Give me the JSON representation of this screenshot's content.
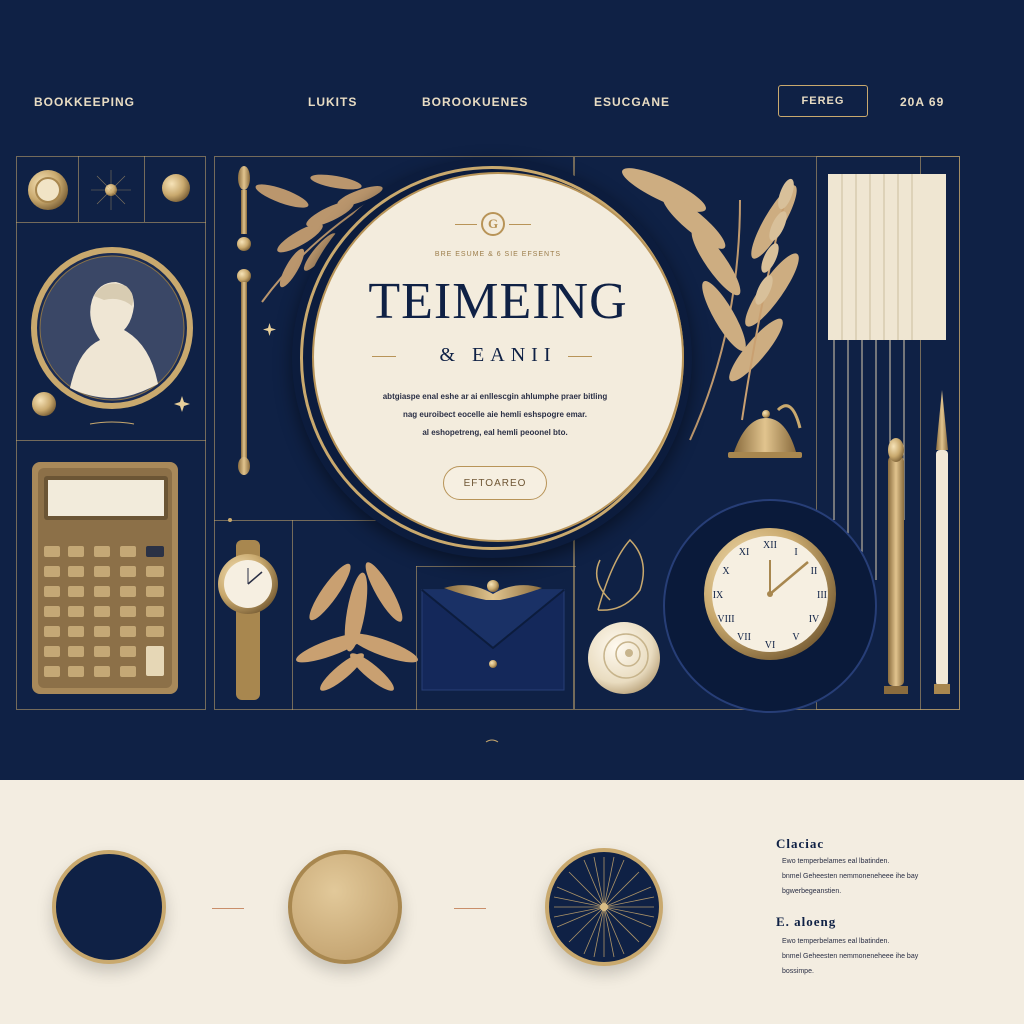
{
  "nav": {
    "items": [
      "BOOKKEEPING",
      "LUKITS",
      "BOROOKUENES",
      "ESUCGANE"
    ],
    "button_label": "FEREG",
    "right_label": "20A 69"
  },
  "hero": {
    "emblem": "G",
    "tagline": "BRE ESUME & 6 SIE EFSENTS",
    "title": "TEIMEING",
    "subtitle": "& EANII",
    "body_lines": [
      "abtgiaspe enal eshe ar ai enllescgin ahlumphe praer bitling",
      "nag euroibect eocelle aie hemli eshspogre emar.",
      "al eshopetreng, eal hemli peoonel bto."
    ],
    "cta_label": "EFTOAREO"
  },
  "features": [
    {
      "title": "Claciac",
      "lines": [
        "Ewo temperbelames eal lbatinden.",
        "bnmel Geheesten nemmoneneheee ihe bay",
        "bgwerbegeanstien."
      ]
    },
    {
      "title": "E. aloeng",
      "lines": [
        "Ewo temperbelames eal lbatinden.",
        "bnmel Geheesten nemmoneneheee ihe bay",
        "bossimpe."
      ]
    }
  ],
  "colors": {
    "navy": "#0f2145",
    "gold": "#c9a96e",
    "cream": "#f3ede1"
  }
}
